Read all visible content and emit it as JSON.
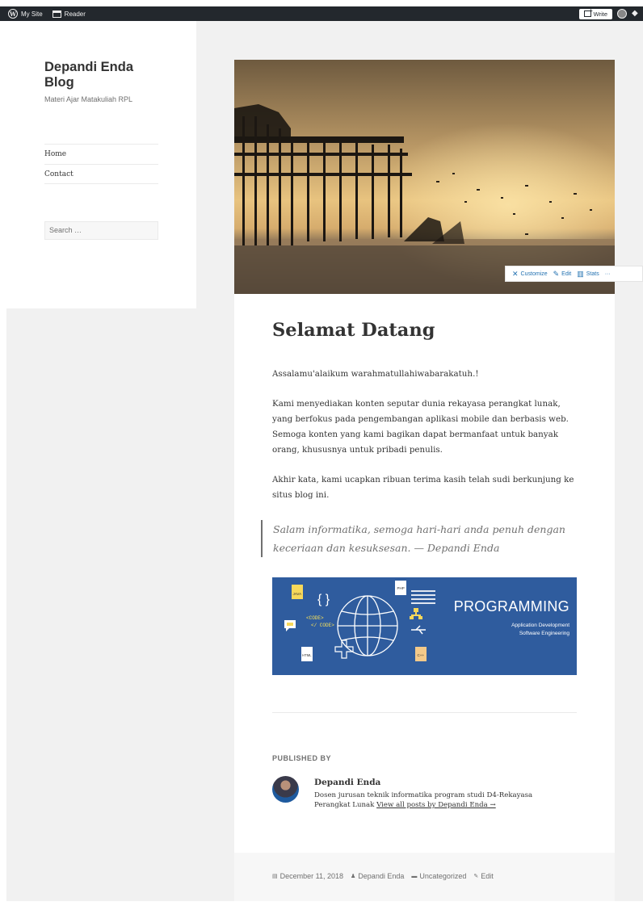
{
  "adminbar": {
    "my_site": "My Site",
    "reader": "Reader",
    "write": "Write"
  },
  "sidebar": {
    "site_title": "Depandi Enda Blog",
    "site_description": "Materi Ajar Matakuliah RPL",
    "nav": [
      {
        "label": "Home"
      },
      {
        "label": "Contact"
      }
    ],
    "search_placeholder": "Search …"
  },
  "toolbar": {
    "customize": "Customize",
    "edit": "Edit",
    "stats": "Stats",
    "more": "···"
  },
  "post": {
    "title": "Selamat Datang",
    "paragraphs": [
      "Assalamu'alaikum warahmatullahiwabarakatuh.!",
      "Kami menyediakan konten seputar dunia rekayasa perangkat lunak, yang berfokus pada pengembangan aplikasi mobile dan berbasis web. Semoga konten yang kami bagikan dapat bermanfaat untuk banyak orang, khususnya untuk pribadi penulis.",
      "Akhir kata, kami ucapkan ribuan terima kasih telah sudi berkunjung ke situs blog ini."
    ],
    "quote": "Salam informatika, semoga hari-hari anda penuh dengan keceriaan dan kesuksesan. — Depandi Enda",
    "banner": {
      "title": "PROGRAMMING",
      "sub1": "Application Development",
      "sub2": "Software Engineering",
      "labels": {
        "java": "JAVA",
        "php": "PHP",
        "html": "HTML",
        "cpp": "C++",
        "code_open": "<CODE>",
        "code_close": "</ CODE>",
        "braces": "{ }"
      }
    },
    "published_by": "PUBLISHED BY",
    "author": {
      "name": "Depandi Enda",
      "bio": "Dosen jurusan teknik informatika program studi D4-Rekayasa Perangkat Lunak ",
      "link": "View all posts by Depandi Enda →"
    },
    "footer": {
      "date": "December 11, 2018",
      "author": "Depandi Enda",
      "category": "Uncategorized",
      "edit": "Edit"
    }
  },
  "colors": {
    "adminbar": "#23282d",
    "page_bg": "#f1f1f1",
    "banner_bg": "#2f5c9e",
    "link_blue": "#2271b1"
  }
}
